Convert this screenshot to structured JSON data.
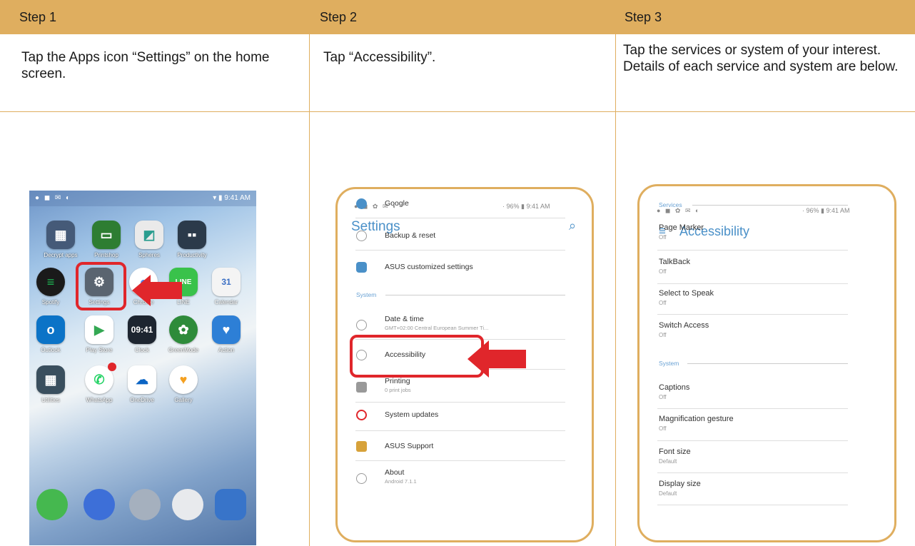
{
  "header": {
    "step1": "Step 1",
    "step2": "Step 2",
    "step3": "Step 3"
  },
  "instructions": {
    "step1": "Tap the Apps icon “Settings” on the home screen.",
    "step2": "Tap “Accessibility”.",
    "step3": "Tap the services or system of your interest. Details of each service and system are below."
  },
  "phone1": {
    "apps": [
      {
        "label": "Decrypt apps"
      },
      {
        "label": "Printshop"
      },
      {
        "label": "Spheres"
      },
      {
        "label": "Productivity"
      },
      {
        "label": "Spotify"
      },
      {
        "label": "Settings"
      },
      {
        "label": "Chrome"
      },
      {
        "label": "LINE"
      },
      {
        "label": "Calendar"
      },
      {
        "label": "Outlook"
      },
      {
        "label": "Play Store"
      },
      {
        "label": "Clock"
      },
      {
        "label": "GreenMode"
      },
      {
        "label": "Action"
      },
      {
        "label": "Utilities"
      },
      {
        "label": "WhatsApp"
      },
      {
        "label": "OneDrive"
      },
      {
        "label": "Gallery"
      }
    ],
    "clock_text": "09:41"
  },
  "phone2": {
    "status_right": "· 96% ▮ 9:41 AM",
    "title": "Settings",
    "section_system": "System",
    "items_top": [
      {
        "title": "Google"
      },
      {
        "title": "Backup & reset"
      },
      {
        "title": "ASUS customized settings"
      }
    ],
    "items_system": [
      {
        "title": "Date & time",
        "sub": "GMT+02:00 Central European Summer Ti..."
      },
      {
        "title": "Accessibility"
      },
      {
        "title": "Printing",
        "sub": "0 print jobs"
      },
      {
        "title": "System updates"
      },
      {
        "title": "ASUS Support"
      },
      {
        "title": "About",
        "sub": "Android 7.1.1"
      }
    ]
  },
  "phone3": {
    "status_right": "· 96% ▮ 9:41 AM",
    "title": "Accessibility",
    "section_services": "Services",
    "section_system": "System",
    "services": [
      {
        "title": "Page Marker",
        "sub": "Off"
      },
      {
        "title": "TalkBack",
        "sub": "Off"
      },
      {
        "title": "Select to Speak",
        "sub": "Off"
      },
      {
        "title": "Switch Access",
        "sub": "Off"
      }
    ],
    "system": [
      {
        "title": "Captions",
        "sub": "Off"
      },
      {
        "title": "Magnification gesture",
        "sub": "Off"
      },
      {
        "title": "Font size",
        "sub": "Default"
      },
      {
        "title": "Display size",
        "sub": "Default"
      }
    ]
  },
  "colors": {
    "header": "#dfae5f",
    "highlight": "#e0262b",
    "accent": "#4a90c8"
  }
}
